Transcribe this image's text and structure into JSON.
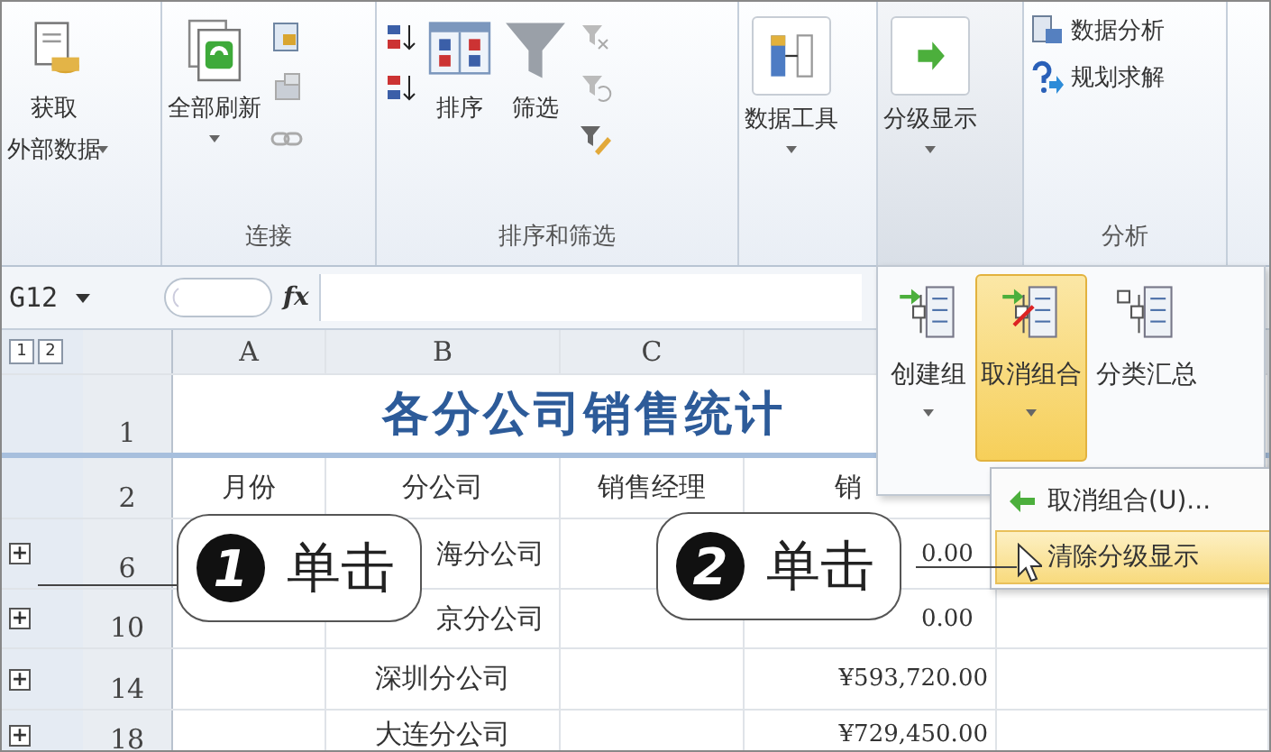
{
  "ribbon": {
    "get_data": {
      "label": [
        "获取",
        "外部数据"
      ],
      "dropdown": true
    },
    "connections": {
      "label": "连接",
      "refresh": {
        "label": "全部刷新",
        "dropdown": true
      }
    },
    "sort_filter": {
      "label": "排序和筛选",
      "sort": {
        "label": "排序"
      },
      "filter": {
        "label": "筛选"
      }
    },
    "data_tools": {
      "label": "数据工具",
      "dropdown": true
    },
    "outline": {
      "label": "分级显示",
      "dropdown": true,
      "pressed": true
    },
    "analysis": {
      "label": "分析",
      "items": [
        {
          "label": "数据分析"
        },
        {
          "label": "规划求解"
        }
      ]
    }
  },
  "formula_bar": {
    "name_box": "G12",
    "fx": "fx"
  },
  "sheet": {
    "outline_levels": [
      "1",
      "2"
    ],
    "columns": [
      "A",
      "B",
      "C"
    ],
    "title": "各分公司销售统计",
    "header_row": {
      "row": "2",
      "a": "月份",
      "b": "分公司",
      "c": "销售经理",
      "d": "销"
    },
    "title_row": "1",
    "rows": [
      {
        "row": "6",
        "expand": "+",
        "b": "海分公司",
        "d": "0.00"
      },
      {
        "row": "10",
        "expand": "+",
        "b": "京分公司",
        "d": "0.00"
      },
      {
        "row": "14",
        "expand": "+",
        "b": "深圳分公司",
        "d": "¥593,720.00"
      },
      {
        "row": "18",
        "expand": "+",
        "b": "大连分公司",
        "d": "¥729,450.00"
      }
    ]
  },
  "outline_panel": {
    "buttons": [
      {
        "label": "创建组",
        "dropdown": true,
        "selected": false
      },
      {
        "label": "取消组合",
        "dropdown": true,
        "selected": true
      },
      {
        "label": "分类汇总",
        "dropdown": false,
        "selected": false
      }
    ]
  },
  "menu": {
    "items": [
      {
        "label": "取消组合(U)...",
        "icon": true,
        "selected": false
      },
      {
        "label": "清除分级显示",
        "icon": false,
        "selected": true
      }
    ]
  },
  "callouts": [
    {
      "number": "1",
      "text": "单击"
    },
    {
      "number": "2",
      "text": "单击"
    }
  ]
}
